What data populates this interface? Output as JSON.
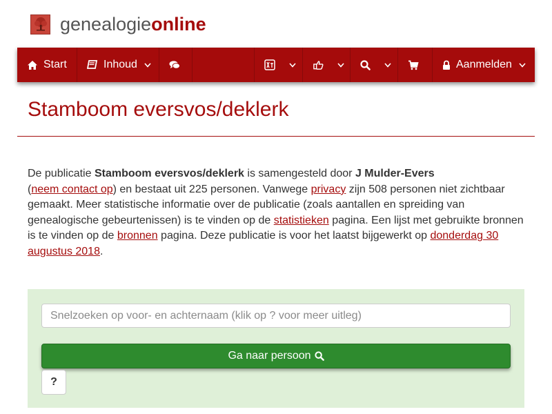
{
  "brand": {
    "name_part1": "genealogie",
    "name_part2": "online",
    "logo_icon": "tree-icon"
  },
  "navbar": {
    "start_label": "Start",
    "inhoud_label": "Inhoud",
    "login_label": "Aanmelden",
    "icons": [
      "home-icon",
      "book-icon",
      "comments-icon",
      "language-icon",
      "share-icon",
      "search-icon",
      "cart-icon",
      "lock-icon"
    ]
  },
  "page": {
    "title": "Stamboom eversvos/deklerk"
  },
  "intro": {
    "t1": "De publicatie ",
    "pub_name": "Stamboom eversvos/deklerk",
    "t2": " is samengesteld door ",
    "author": "J Mulder-Evers",
    "t3": " (",
    "contact_link": "neem contact op",
    "t4": ") en bestaat uit 225 personen. Vanwege ",
    "privacy_link": "privacy",
    "t5": " zijn 508 personen niet zichtbaar gemaakt. Meer statistische informatie over de publicatie (zoals aantallen en spreiding van genealogische gebeurtenissen) is te vinden op de ",
    "stats_link": "statistieken",
    "t6": " pagina. Een lijst met gebruikte bronnen is te vinden op de ",
    "sources_link": "bronnen",
    "t7": " pagina. Deze publicatie is voor het laatst bijgewerkt op ",
    "date_link": "donderdag 30 augustus 2018",
    "t8": "."
  },
  "search": {
    "placeholder": "Snelzoeken op voor- en achternaam (klik op ? voor meer uitleg)",
    "button_label": "Ga naar persoon",
    "help_label": "?"
  },
  "colors": {
    "brand_red": "#a50d0d",
    "panel_green": "#dff0d8",
    "button_green": "#2e8b2e"
  }
}
